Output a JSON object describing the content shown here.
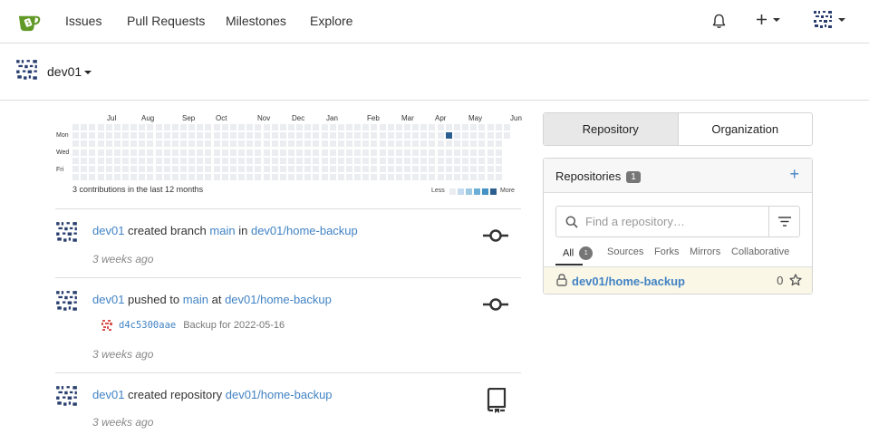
{
  "nav": {
    "items": [
      "Issues",
      "Pull Requests",
      "Milestones",
      "Explore"
    ]
  },
  "context": {
    "name": "dev01"
  },
  "heatmap": {
    "months": [
      "Jul",
      "Aug",
      "Sep",
      "Oct",
      "Nov",
      "Dec",
      "Jan",
      "Feb",
      "Mar",
      "Apr",
      "May",
      "Jun"
    ],
    "days": [
      "Mon",
      "Wed",
      "Fri"
    ],
    "caption": "3 contributions in the last 12 months",
    "legend_less": "Less",
    "legend_more": "More",
    "active_week": 45,
    "active_day": 1,
    "colors": {
      "empty": "#ebedf0",
      "scale": [
        "#c6dbef",
        "#9ecae1",
        "#6baed6",
        "#4292c6",
        "#2c5f8f"
      ]
    }
  },
  "feed": [
    {
      "user": "dev01",
      "action": "created branch",
      "ref": "main",
      "prep": "in",
      "repo": "dev01/home-backup",
      "time": "3 weeks ago",
      "icon": "git-commit-icon"
    },
    {
      "user": "dev01",
      "action": "pushed to",
      "ref": "main",
      "prep": "at",
      "repo": "dev01/home-backup",
      "time": "3 weeks ago",
      "icon": "git-commit-icon",
      "commit_sha": "d4c5300aae",
      "commit_msg": "Backup for 2022-05-16"
    },
    {
      "user": "dev01",
      "action": "created repository",
      "repo": "dev01/home-backup",
      "time": "3 weeks ago",
      "icon": "repo-icon"
    }
  ],
  "segments": {
    "repository": "Repository",
    "organization": "Organization"
  },
  "repos": {
    "title": "Repositories",
    "count": "1",
    "search_placeholder": "Find a repository…",
    "tabs": {
      "all": "All",
      "all_count": "1",
      "sources": "Sources",
      "forks": "Forks",
      "mirrors": "Mirrors",
      "collaborative": "Collaborative"
    },
    "items": [
      {
        "name": "dev01/home-backup",
        "stars": "0"
      }
    ]
  },
  "colors": {
    "link": "#4183c4",
    "accent_green": "#609926"
  }
}
